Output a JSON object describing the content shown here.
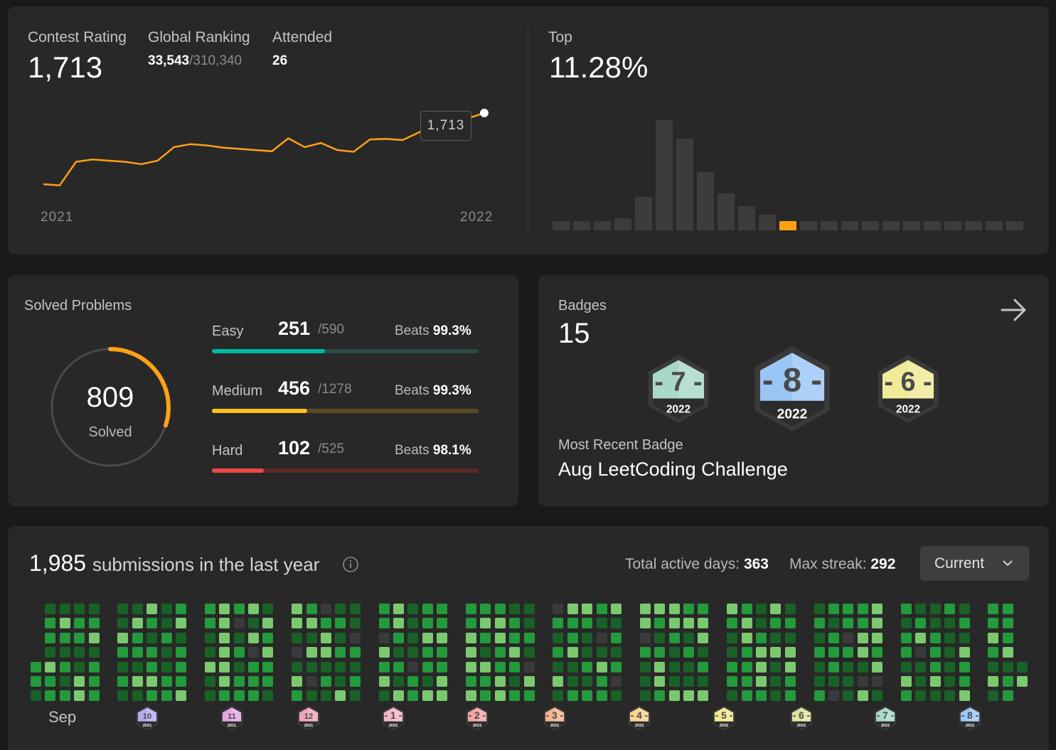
{
  "contest": {
    "rating_label": "Contest Rating",
    "rating": "1,713",
    "ranking_label": "Global Ranking",
    "ranking": "33,543",
    "ranking_total": "/310,340",
    "attended_label": "Attended",
    "attended": "26",
    "top_label": "Top",
    "top_value": "11.28%",
    "tooltip": "1,713",
    "year_start": "2021",
    "year_end": "2022",
    "line_color": "#ffa116",
    "rating_history": [
      1592,
      1590,
      1630,
      1634,
      1632,
      1630,
      1626,
      1632,
      1655,
      1660,
      1658,
      1654,
      1652,
      1650,
      1648,
      1670,
      1655,
      1662,
      1650,
      1647,
      1668,
      1669,
      1667,
      1680,
      1700,
      1701,
      1704,
      1713
    ],
    "distribution": [
      3,
      3,
      3,
      4,
      11,
      36,
      30,
      19,
      12,
      8,
      5,
      3,
      3,
      3,
      3,
      3,
      3,
      3,
      3,
      3,
      3,
      3,
      3
    ],
    "distribution_highlight_index": 11
  },
  "solved": {
    "title": "Solved Problems",
    "total": "809",
    "total_label": "Solved",
    "ring_color": "#ffa116",
    "ring_fraction": 0.3,
    "rows": [
      {
        "label": "Easy",
        "count": "251",
        "total": "/590",
        "beats_label": "Beats",
        "beats": "99.3%",
        "fraction": 0.425,
        "color": "#00b8a3",
        "track": "#2a4a46"
      },
      {
        "label": "Medium",
        "count": "456",
        "total": "/1278",
        "beats_label": "Beats",
        "beats": "99.3%",
        "fraction": 0.357,
        "color": "#ffc01e",
        "track": "#5a4a20"
      },
      {
        "label": "Hard",
        "count": "102",
        "total": "/525",
        "beats_label": "Beats",
        "beats": "98.1%",
        "fraction": 0.194,
        "color": "#ef4743",
        "track": "#5a2a2a"
      }
    ]
  },
  "badges": {
    "title": "Badges",
    "count": "15",
    "arrow_icon": "arrow-right-icon",
    "items": [
      {
        "num": "7",
        "year": "2022",
        "color": "#a8d8c8"
      },
      {
        "num": "8",
        "year": "2022",
        "color": "#9ac6f6"
      },
      {
        "num": "6",
        "year": "2022",
        "color": "#efeb96"
      }
    ],
    "recent_label": "Most Recent Badge",
    "recent_name": "Aug LeetCoding Challenge"
  },
  "submissions": {
    "count": "1,985",
    "label": "submissions in the last year",
    "info_icon": "info-icon",
    "active_label": "Total active days:",
    "active_days": "363",
    "streak_label": "Max streak:",
    "max_streak": "292",
    "dropdown": "Current",
    "first_month": "Sep",
    "cell_colors": [
      "#196127",
      "#239a3b",
      "#7bc96f"
    ],
    "months": [
      {
        "num": "10",
        "year": "2021",
        "color": "#b9a9ee"
      },
      {
        "num": "11",
        "year": "2021",
        "color": "#e6a6e6"
      },
      {
        "num": "12",
        "year": "2021",
        "color": "#f0a5b8"
      },
      {
        "num": "1",
        "year": "2022",
        "color": "#f4b5c6"
      },
      {
        "num": "2",
        "year": "2022",
        "color": "#f4a4a4"
      },
      {
        "num": "3",
        "year": "2022",
        "color": "#f5b28d"
      },
      {
        "num": "4",
        "year": "2022",
        "color": "#f5d48e"
      },
      {
        "num": "5",
        "year": "2022",
        "color": "#f1ea8e"
      },
      {
        "num": "6",
        "year": "2022",
        "color": "#dfe39a"
      },
      {
        "num": "7",
        "year": "2022",
        "color": "#a8d8c8"
      },
      {
        "num": "8",
        "year": "2022",
        "color": "#9ac6f6"
      }
    ]
  }
}
